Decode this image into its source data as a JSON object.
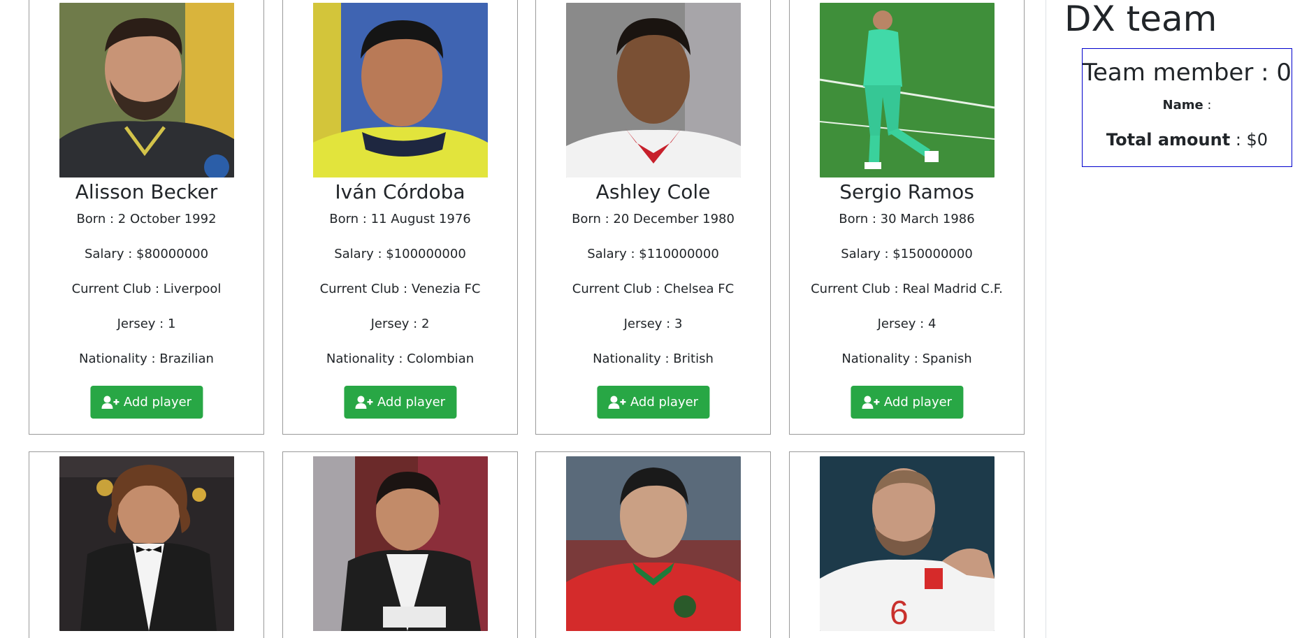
{
  "team": {
    "title": "DX team",
    "member_label": "Team member : ",
    "member_count": "0",
    "name_label": "Name",
    "name_sep": " :",
    "name_value": "",
    "total_label": "Total amount",
    "total_sep": " : ",
    "total_value": "$0",
    "box_border_color": "#0000cc"
  },
  "button": {
    "label": "Add player",
    "color": "#28a745",
    "icon": "user-plus-icon"
  },
  "players": [
    {
      "name": "Alisson Becker",
      "born": "Born : 2 October 1992",
      "salary": "Salary : $80000000",
      "club": "Current Club : Liverpool",
      "jersey": "Jersey : 1",
      "nationality": "Nationality : Brazilian"
    },
    {
      "name": "Iván Córdoba",
      "born": "Born : 11 August 1976",
      "salary": "Salary : $100000000",
      "club": "Current Club : Venezia FC",
      "jersey": "Jersey : 2",
      "nationality": "Nationality : Colombian"
    },
    {
      "name": "Ashley Cole",
      "born": "Born : 20 December 1980",
      "salary": "Salary : $110000000",
      "club": "Current Club : Chelsea FC",
      "jersey": "Jersey : 3",
      "nationality": "Nationality : British"
    },
    {
      "name": "Sergio Ramos",
      "born": "Born : 30 March 1986",
      "salary": "Salary : $150000000",
      "club": "Current Club : Real Madrid C.F.",
      "jersey": "Jersey : 4",
      "nationality": "Nationality : Spanish"
    },
    {
      "name": "",
      "born": "",
      "salary": "",
      "club": "",
      "jersey": "",
      "nationality": ""
    },
    {
      "name": "",
      "born": "",
      "salary": "",
      "club": "",
      "jersey": "",
      "nationality": ""
    },
    {
      "name": "",
      "born": "",
      "salary": "",
      "club": "",
      "jersey": "",
      "nationality": ""
    },
    {
      "name": "",
      "born": "",
      "salary": "",
      "club": "",
      "jersey": "",
      "nationality": ""
    }
  ]
}
